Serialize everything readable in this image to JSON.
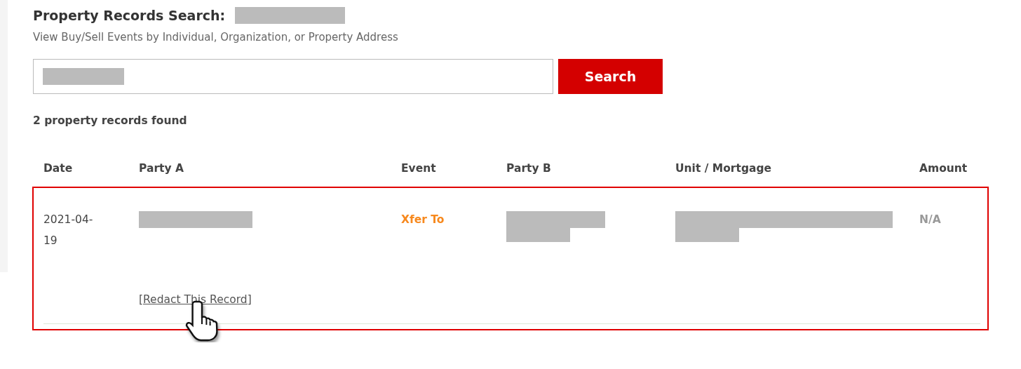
{
  "heading": {
    "title": "Property Records Search:",
    "query": {
      "kind": "redacted"
    }
  },
  "subtitle": "View Buy/Sell Events by Individual, Organization, or Property Address",
  "search": {
    "value": {
      "kind": "redacted"
    },
    "button": "Search"
  },
  "result_count": "2 property records found",
  "table": {
    "columns": [
      "Date",
      "Party A",
      "Event",
      "Party B",
      "Unit / Mortgage",
      "Amount"
    ],
    "rows": [
      {
        "highlighted": true,
        "date": "2021-04-19",
        "party_a": {
          "kind": "redacted"
        },
        "event": "Xfer To",
        "party_b": {
          "kind": "redacted"
        },
        "unit_mortgage": {
          "kind": "redacted"
        },
        "amount": "N/A",
        "action": "[Redact This Record]"
      }
    ]
  }
}
